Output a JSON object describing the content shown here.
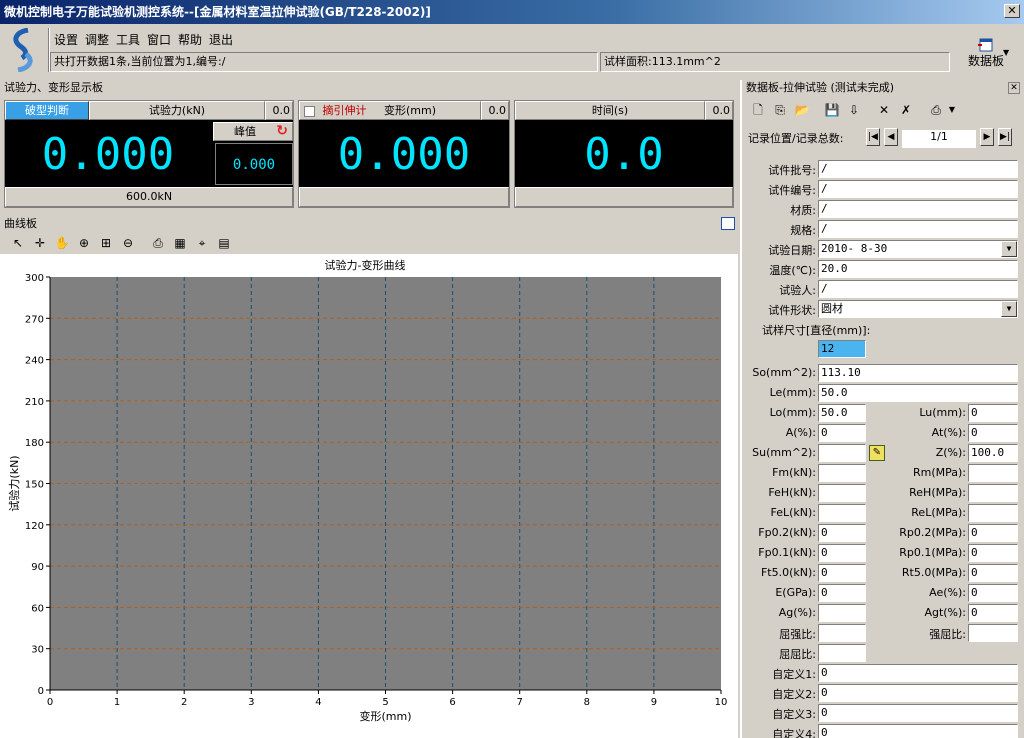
{
  "window": {
    "title": "微机控制电子万能试验机测控系统--[金属材料室温拉伸试验(GB/T228-2002)]",
    "close_label": "✕"
  },
  "menu": {
    "items": [
      "设置",
      "调整",
      "工具",
      "窗口",
      "帮助",
      "退出"
    ],
    "status_text": "共打开数据1条,当前位置为1,编号:/",
    "area_text": "试样面积:113.1mm^2",
    "databoard_label": "数据板"
  },
  "display_panel": {
    "title": "试验力、变形显示板",
    "force": {
      "mode_button": "破型判断",
      "label": "试验力(kN)",
      "corner": "0.0",
      "value": "0.000",
      "peak_label": "峰值",
      "peak_value": "0.000",
      "range": "600.0kN"
    },
    "deform": {
      "extensometer_label": "摘引伸计",
      "label": "变形(mm)",
      "corner": "0.0",
      "value": "0.000"
    },
    "time": {
      "label": "时间(s)",
      "corner": "0.0",
      "value": "0.0"
    }
  },
  "curve_panel": {
    "title": "曲线板",
    "toolbar_icons": [
      "pointer-icon",
      "crosshair-icon",
      "hand-icon",
      "zoom-in-icon",
      "zoom-fit-icon",
      "zoom-out-icon",
      "print-icon",
      "chart-settings-icon",
      "data-cursor-icon",
      "table-view-icon"
    ]
  },
  "chart_data": {
    "type": "line",
    "title": "试验力-变形曲线",
    "xlabel": "变形(mm)",
    "ylabel": "试验力(kN)",
    "xlim": [
      0,
      10
    ],
    "ylim": [
      0,
      300
    ],
    "xticks": [
      "0",
      "1",
      "2",
      "3",
      "4",
      "5",
      "6",
      "7",
      "8",
      "9",
      "10"
    ],
    "yticks": [
      "0",
      "30",
      "60",
      "90",
      "120",
      "150",
      "180",
      "210",
      "240",
      "270",
      "300"
    ],
    "grid": true,
    "series": [],
    "colors": {
      "plot_bg": "#808080",
      "vgrid": "#1e4f6b",
      "hgrid": "#b0601f"
    }
  },
  "data_board": {
    "title": "数据板-拉伸试验 (测试未完成)",
    "record_label": "记录位置/记录总数:",
    "record_value": "1/1",
    "fields_full": [
      {
        "label": "试件批号:",
        "value": "/"
      },
      {
        "label": "试件编号:",
        "value": "/"
      },
      {
        "label": "材质:",
        "value": "/"
      },
      {
        "label": "规格:",
        "value": "/"
      },
      {
        "label": "试验日期:",
        "value": "2010- 8-30",
        "combo": true
      },
      {
        "label": "温度(℃):",
        "value": "20.0"
      },
      {
        "label": "试验人:",
        "value": "/"
      },
      {
        "label": "试件形状:",
        "value": "圆材",
        "combo": true
      }
    ],
    "size_label": "试样尺寸[直径(mm)]:",
    "size_value": "12",
    "so_label": "So(mm^2):",
    "so_value": "113.10",
    "le_label": "Le(mm):",
    "le_value": "50.0",
    "pairs": [
      {
        "l": "Lo(mm):",
        "lv": "50.0",
        "r": "Lu(mm):",
        "rv": "0"
      },
      {
        "l": "A(%):",
        "lv": "0",
        "r": "At(%):",
        "rv": "0"
      },
      {
        "l": "Su(mm^2):",
        "lv": "",
        "r": "Z(%):",
        "rv": "100.0"
      },
      {
        "l": "Fm(kN):",
        "lv": "",
        "r": "Rm(MPa):",
        "rv": ""
      },
      {
        "l": "FeH(kN):",
        "lv": "",
        "r": "ReH(MPa):",
        "rv": ""
      },
      {
        "l": "FeL(kN):",
        "lv": "",
        "r": "ReL(MPa):",
        "rv": ""
      },
      {
        "l": "Fp0.2(kN):",
        "lv": "0",
        "r": "Rp0.2(MPa):",
        "rv": "0"
      },
      {
        "l": "Fp0.1(kN):",
        "lv": "0",
        "r": "Rp0.1(MPa):",
        "rv": "0"
      },
      {
        "l": "Ft5.0(kN):",
        "lv": "0",
        "r": "Rt5.0(MPa):",
        "rv": "0"
      },
      {
        "l": "E(GPa):",
        "lv": "0",
        "r": "Ae(%):",
        "rv": "0"
      },
      {
        "l": "Ag(%):",
        "lv": "",
        "r": "Agt(%):",
        "rv": "0"
      },
      {
        "l": "屈强比:",
        "lv": "",
        "r": "强屈比:",
        "rv": ""
      },
      {
        "l": "屈屈比:",
        "lv": "",
        "r": "",
        "rv": null
      }
    ],
    "custom": [
      {
        "label": "自定义1:",
        "value": "0"
      },
      {
        "label": "自定义2:",
        "value": "0"
      },
      {
        "label": "自定义3:",
        "value": "0"
      },
      {
        "label": "自定义4:",
        "value": "0"
      }
    ]
  }
}
